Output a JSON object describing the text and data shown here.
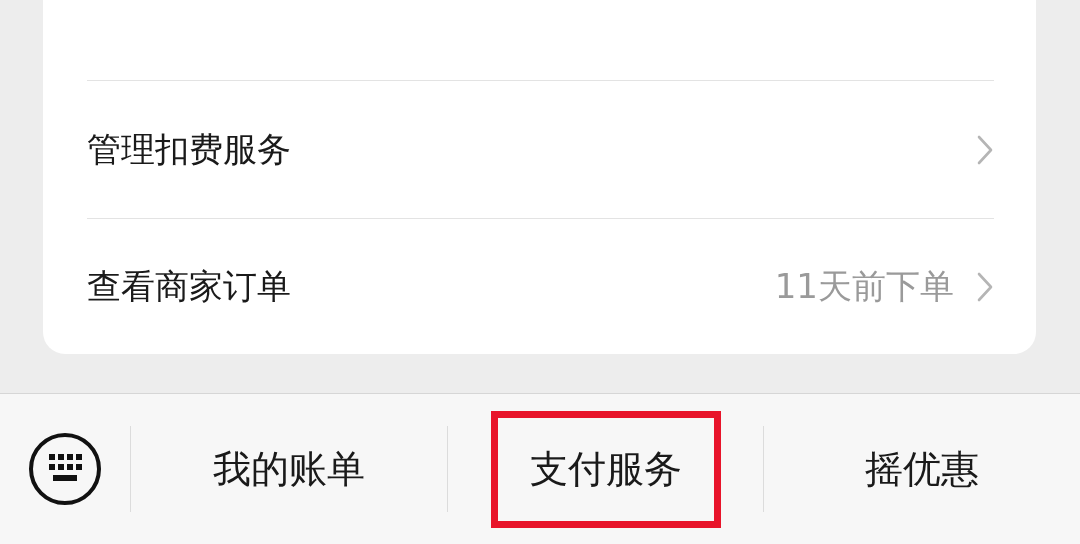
{
  "rows": [
    {
      "label": "管理扣费服务"
    },
    {
      "label": "查看商家订单",
      "hint": "11天前下单"
    }
  ],
  "menu": [
    {
      "label": "我的账单",
      "highlighted": false
    },
    {
      "label": "支付服务",
      "highlighted": true
    },
    {
      "label": "摇优惠",
      "highlighted": false
    }
  ]
}
